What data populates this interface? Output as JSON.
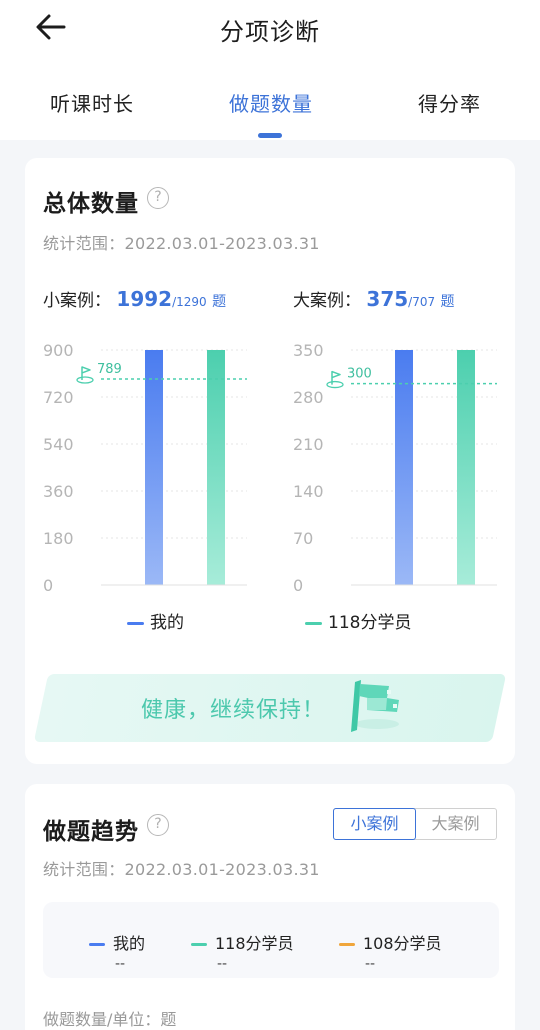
{
  "header": {
    "title": "分项诊断",
    "tabs": [
      {
        "label": "听课时长",
        "active": false
      },
      {
        "label": "做题数量",
        "active": true
      },
      {
        "label": "得分率",
        "active": false
      }
    ]
  },
  "colors": {
    "accent": "#3d73d8",
    "mine_bar": "#4a7cf0",
    "peer_bar": "#4ccfae",
    "orange": "#f0a63c"
  },
  "overview": {
    "title": "总体数量",
    "help": "?",
    "range": "统计范围：2022.03.01-2023.03.31",
    "small": {
      "label": "小案例：",
      "value": "1992",
      "total": "/1290",
      "unit": "题"
    },
    "large": {
      "label": "大案例：",
      "value": "375",
      "total": "/707",
      "unit": "题"
    },
    "legend_mine": "我的",
    "legend_peer": "118分学员",
    "banner": "健康，继续保持！"
  },
  "chart_data": [
    {
      "type": "bar",
      "categories": [
        "我的",
        "118分学员"
      ],
      "values": [
        900,
        900
      ],
      "ylim": [
        0,
        900
      ],
      "yticks": [
        "0",
        "180",
        "360",
        "540",
        "720",
        "900"
      ],
      "reference": {
        "value": 789,
        "label": "789"
      }
    },
    {
      "type": "bar",
      "categories": [
        "我的",
        "118分学员"
      ],
      "values": [
        350,
        350
      ],
      "ylim": [
        0,
        350
      ],
      "yticks": [
        "0",
        "70",
        "140",
        "210",
        "280",
        "350"
      ],
      "reference": {
        "value": 300,
        "label": "300"
      }
    }
  ],
  "trend": {
    "title": "做题趋势",
    "help": "?",
    "segments": [
      {
        "label": "小案例",
        "active": true
      },
      {
        "label": "大案例",
        "active": false
      }
    ],
    "range": "统计范围：2022.03.01-2023.03.31",
    "legend": [
      {
        "label": "我的",
        "value": "--"
      },
      {
        "label": "118分学员",
        "value": "--"
      },
      {
        "label": "108分学员",
        "value": "--"
      }
    ],
    "unit_label": "做题数量/单位：题"
  }
}
